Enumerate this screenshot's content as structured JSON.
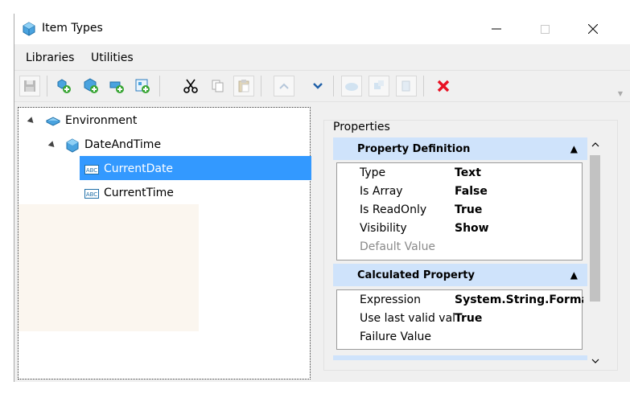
{
  "window": {
    "title": "Item Types"
  },
  "menu": [
    "Libraries",
    "Utilities"
  ],
  "toolbar": {
    "buttons": [
      "save-icon",
      "add-library-icon",
      "add-item-type-icon",
      "add-property-icon",
      "import-icon",
      "cut-icon",
      "copy-icon",
      "paste-icon",
      "move-up-icon",
      "move-down-icon",
      "disabled-a-icon",
      "disabled-b-icon",
      "disabled-c-icon",
      "delete-icon"
    ]
  },
  "tree": {
    "root": "Environment",
    "child": "DateAndTime",
    "leaves": [
      "CurrentDate",
      "CurrentTime"
    ],
    "selected": "CurrentDate"
  },
  "properties": {
    "label": "Properties",
    "sections": [
      {
        "title": "Property Definition",
        "rows": [
          {
            "key": "Type",
            "value": "Text"
          },
          {
            "key": "Is Array",
            "value": "False"
          },
          {
            "key": "Is ReadOnly",
            "value": "True"
          },
          {
            "key": "Visibility",
            "value": "Show"
          },
          {
            "key": "Default Value",
            "value": ""
          }
        ]
      },
      {
        "title": "Calculated Property",
        "rows": [
          {
            "key": "Expression",
            "value": "System.String.Format ("
          },
          {
            "key": "Use last valid valu",
            "value": "True"
          },
          {
            "key": "Failure Value",
            "value": ""
          }
        ]
      }
    ]
  },
  "colors": {
    "selection": "#3399ff",
    "section_header": "#cfe3fb",
    "delete": "#e81123"
  }
}
